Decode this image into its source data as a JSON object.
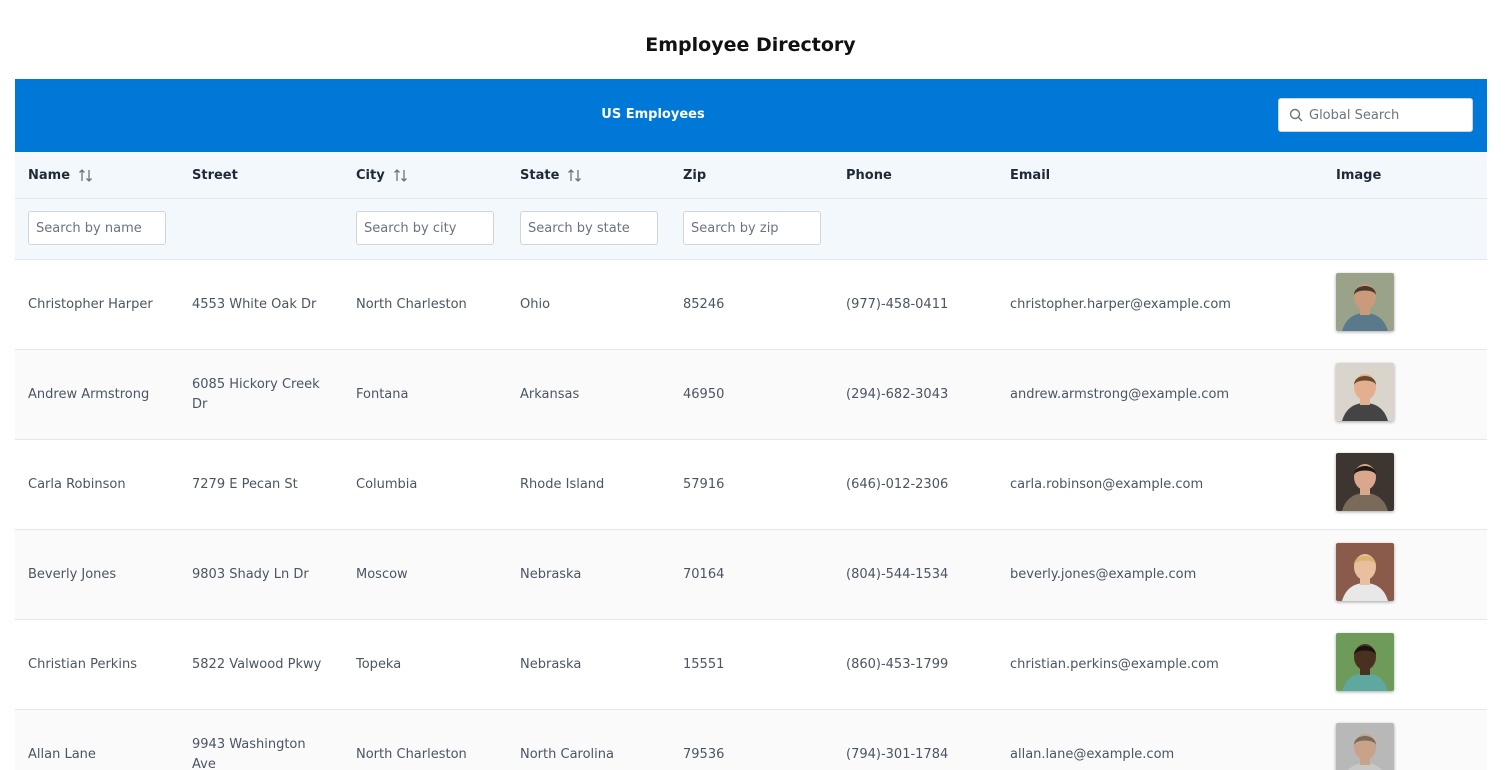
{
  "title": "Employee Directory",
  "caption": "US Employees",
  "global_search": {
    "placeholder": "Global Search"
  },
  "columns": [
    {
      "key": "name",
      "label": "Name",
      "sortable": true
    },
    {
      "key": "street",
      "label": "Street",
      "sortable": false
    },
    {
      "key": "city",
      "label": "City",
      "sortable": true
    },
    {
      "key": "state",
      "label": "State",
      "sortable": true
    },
    {
      "key": "zip",
      "label": "Zip",
      "sortable": false
    },
    {
      "key": "phone",
      "label": "Phone",
      "sortable": false
    },
    {
      "key": "email",
      "label": "Email",
      "sortable": false
    },
    {
      "key": "image",
      "label": "Image",
      "sortable": false
    }
  ],
  "filters": {
    "name": "Search by name",
    "city": "Search by city",
    "state": "Search by state",
    "zip": "Search by zip"
  },
  "colors": {
    "header_bg": "#0078d7",
    "subheader_bg": "#f3f8fd"
  },
  "rows": [
    {
      "name": "Christopher Harper",
      "street": "4553 White Oak Dr",
      "city": "North Charleston",
      "state": "Ohio",
      "zip": "85246",
      "phone": "(977)-458-0411",
      "email": "christopher.harper@example.com",
      "image": "person-photo"
    },
    {
      "name": "Andrew Armstrong",
      "street": "6085 Hickory Creek Dr",
      "city": "Fontana",
      "state": "Arkansas",
      "zip": "46950",
      "phone": "(294)-682-3043",
      "email": "andrew.armstrong@example.com",
      "image": "person-photo"
    },
    {
      "name": "Carla Robinson",
      "street": "7279 E Pecan St",
      "city": "Columbia",
      "state": "Rhode Island",
      "zip": "57916",
      "phone": "(646)-012-2306",
      "email": "carla.robinson@example.com",
      "image": "person-photo"
    },
    {
      "name": "Beverly Jones",
      "street": "9803 Shady Ln Dr",
      "city": "Moscow",
      "state": "Nebraska",
      "zip": "70164",
      "phone": "(804)-544-1534",
      "email": "beverly.jones@example.com",
      "image": "person-photo"
    },
    {
      "name": "Christian Perkins",
      "street": "5822 Valwood Pkwy",
      "city": "Topeka",
      "state": "Nebraska",
      "zip": "15551",
      "phone": "(860)-453-1799",
      "email": "christian.perkins@example.com",
      "image": "person-photo"
    },
    {
      "name": "Allan Lane",
      "street": "9943 Washington Ave",
      "city": "North Charleston",
      "state": "North Carolina",
      "zip": "79536",
      "phone": "(794)-301-1784",
      "email": "allan.lane@example.com",
      "image": "person-photo"
    }
  ]
}
